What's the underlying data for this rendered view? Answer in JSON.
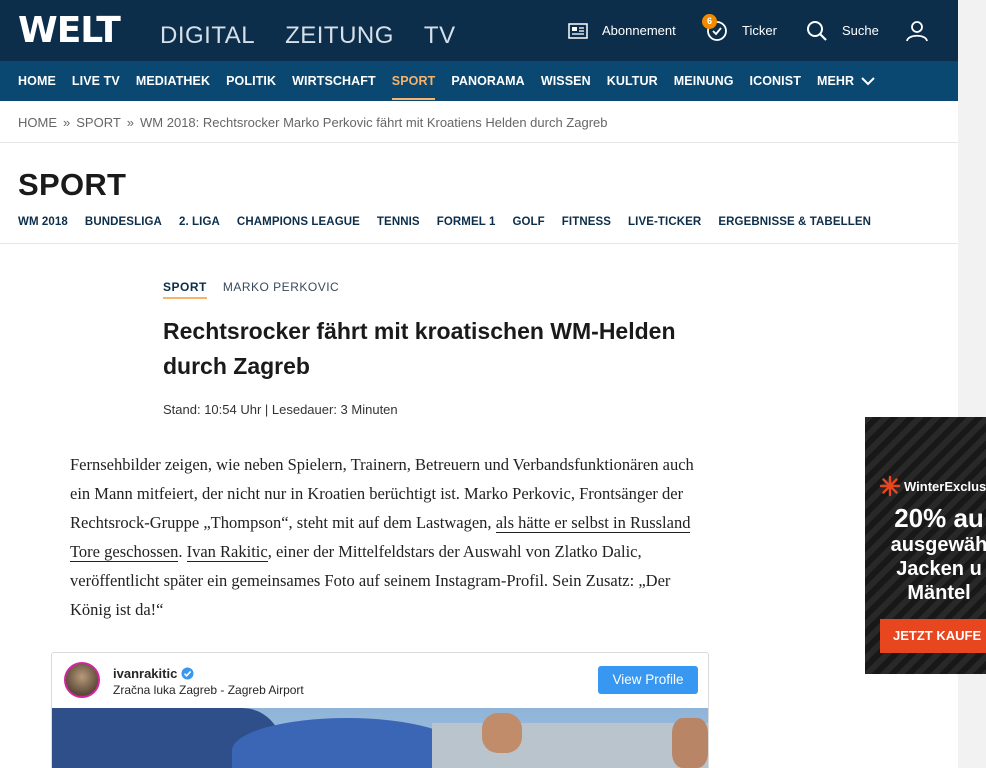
{
  "header": {
    "logo": "WELT",
    "sections": [
      "DIGITAL",
      "ZEITUNG",
      "TV"
    ],
    "abonnement": "Abonnement",
    "ticker": "Ticker",
    "ticker_badge": "6",
    "search": "Suche"
  },
  "nav": {
    "items": [
      "HOME",
      "LIVE TV",
      "MEDIATHEK",
      "POLITIK",
      "WIRTSCHAFT",
      "SPORT",
      "PANORAMA",
      "WISSEN",
      "KULTUR",
      "MEINUNG",
      "ICONIST",
      "MEHR"
    ],
    "active": "SPORT"
  },
  "breadcrumb": {
    "items": [
      "HOME",
      "SPORT",
      "WM 2018: Rechtsrocker Marko Perkovic fährt mit Kroatiens Helden durch Zagreb"
    ],
    "separator": "»"
  },
  "section": {
    "title": "SPORT",
    "subnav": [
      "WM 2018",
      "BUNDESLIGA",
      "2. LIGA",
      "CHAMPIONS LEAGUE",
      "TENNIS",
      "FORMEL 1",
      "GOLF",
      "FITNESS",
      "LIVE-TICKER",
      "ERGEBNISSE & TABELLEN"
    ]
  },
  "article": {
    "kicker_section": "SPORT",
    "kicker_topic": "MARKO PERKOVIC",
    "headline_line1": "Rechtsrocker fährt mit kroatischen WM-Helden",
    "headline_line2": "durch Zagreb",
    "meta": "Stand: 10:54 Uhr | Lesedauer: 3 Minuten",
    "p_part1": "Fernsehbilder zeigen, wie neben Spielern, Trainern, Betreuern und Verbandsfunktionären auch ein Mann mitfeiert, der nicht nur in Kroatien berüchtigt ist. Marko Perkovic, Frontsänger der Rechtsrock-Gruppe „Thompson“, steht mit auf dem Lastwagen, ",
    "p_link1": "als hätte er selbst in Russland Tore geschossen",
    "p_part2": ". ",
    "p_link2": "Ivan Rakitic",
    "p_part3": ", einer der Mittelfeldstars der Auswahl von Zlatko Dalic, veröffentlicht später ein gemeinsames Foto auf seinem Instagram-Profil. Sein Zusatz: „Der König ist da!“"
  },
  "instagram": {
    "username": "ivanrakitic",
    "location": "Zračna luka Zagreb - Zagreb Airport",
    "view_profile": "View Profile"
  },
  "ad": {
    "brand": "WinterExclus",
    "line1": "20% au",
    "line2": "ausgewäh",
    "line3": "Jacken u",
    "line4": "Mäntel",
    "cta": "JETZT KAUFE"
  },
  "colors": {
    "header_bg": "#0c2e4a",
    "nav_bg": "#0a4872",
    "accent": "#f7b26b",
    "badge": "#f08a00",
    "instagram_button": "#3897f0",
    "ad_cta": "#e8461e"
  },
  "icons": {
    "abonnement": "newspaper-icon",
    "ticker": "clock-check-icon",
    "search": "search-icon",
    "user": "user-icon",
    "mehr": "chevron-down-icon",
    "verified": "verified-badge-icon"
  }
}
